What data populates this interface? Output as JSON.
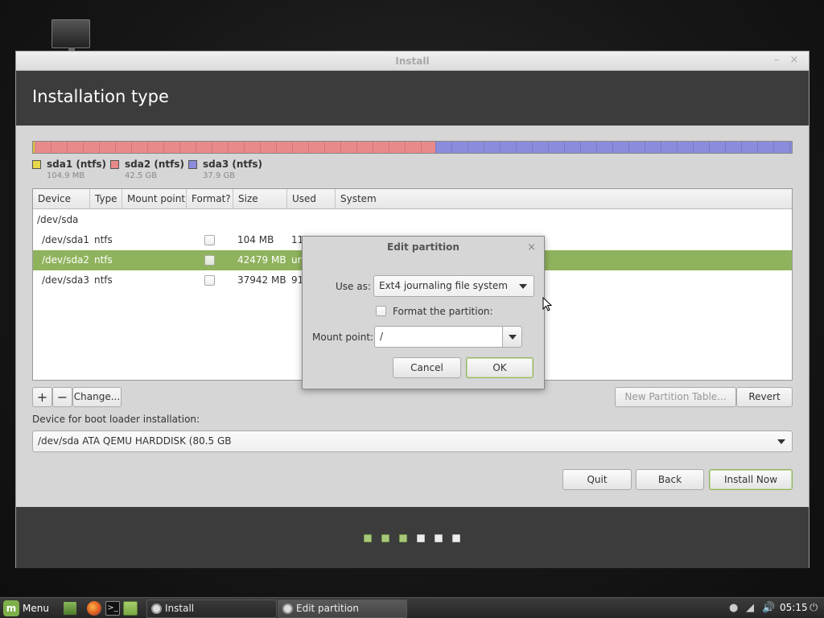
{
  "window": {
    "title": "Install",
    "minimize_label": "–",
    "close_label": "×"
  },
  "header": {
    "title": "Installation type"
  },
  "partition_bar": {
    "legend": [
      {
        "name": "sda1 (ntfs)",
        "size": "104.9 MB",
        "color": "#e6d84a"
      },
      {
        "name": "sda2 (ntfs)",
        "size": "42.5 GB",
        "color": "#e88a8a"
      },
      {
        "name": "sda3 (ntfs)",
        "size": "37.9 GB",
        "color": "#8c8cdc"
      }
    ]
  },
  "table": {
    "columns": [
      "Device",
      "Type",
      "Mount point",
      "Format?",
      "Size",
      "Used",
      "System"
    ],
    "rows": [
      {
        "device": "/dev/sda",
        "type": "",
        "mount": "",
        "size": "",
        "used": "",
        "system": ""
      },
      {
        "device": "/dev/sda1",
        "type": "ntfs",
        "mount": "",
        "size": "104 MB",
        "used": "11",
        "system": ""
      },
      {
        "device": "/dev/sda2",
        "type": "ntfs",
        "mount": "",
        "size": "42479 MB",
        "used": "un",
        "system": ""
      },
      {
        "device": "/dev/sda3",
        "type": "ntfs",
        "mount": "",
        "size": "37942 MB",
        "used": "91",
        "system": ""
      }
    ]
  },
  "toolbar": {
    "add_label": "+",
    "remove_label": "−",
    "change_label": "Change...",
    "new_table_label": "New Partition Table...",
    "revert_label": "Revert"
  },
  "bootloader": {
    "label": "Device for boot loader installation:",
    "selected": "/dev/sda   ATA QEMU HARDDISK (80.5 GB"
  },
  "actions": {
    "quit_label": "Quit",
    "back_label": "Back",
    "install_label": "Install Now"
  },
  "progress": {
    "completed_steps": 3,
    "total_steps": 6
  },
  "dialog": {
    "title": "Edit partition",
    "close_label": "×",
    "use_as_label": "Use as:",
    "use_as_value": "Ext4 journaling file system",
    "format_label": "Format the partition:",
    "mount_label": "Mount point:",
    "mount_value": "/",
    "cancel_label": "Cancel",
    "ok_label": "OK"
  },
  "taskbar": {
    "menu_label": "Menu",
    "tasks": [
      {
        "label": "Install"
      },
      {
        "label": "Edit partition"
      }
    ],
    "clock": "05:15"
  },
  "colors": {
    "accent": "#8fb35c",
    "header_bg": "#3c3c3c",
    "window_bg": "#d6d6d6"
  }
}
